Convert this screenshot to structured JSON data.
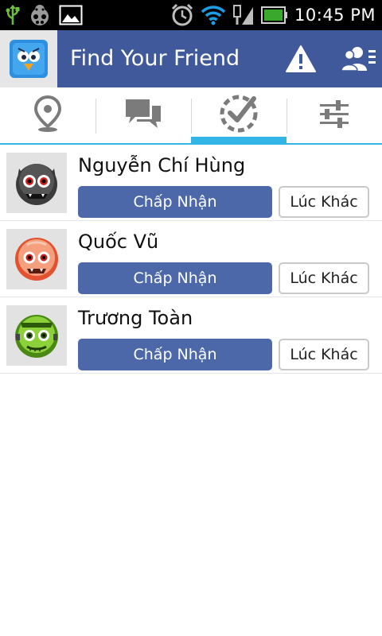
{
  "status_bar": {
    "time": "10:45 PM",
    "left_icons": [
      "usb-icon",
      "bug-icon",
      "image-icon"
    ],
    "right_icons": [
      "alarm-icon",
      "wifi-icon",
      "signal-icon",
      "battery-icon"
    ]
  },
  "action_bar": {
    "title": "Find Your Friend",
    "icons": [
      "app-logo-icon",
      "warning-icon",
      "friends-list-icon"
    ],
    "color": "#3f599a"
  },
  "tabs": [
    {
      "icon": "location-icon",
      "selected": false
    },
    {
      "icon": "chat-icon",
      "selected": false
    },
    {
      "icon": "check-circle-icon",
      "selected": true
    },
    {
      "icon": "settings-sliders-icon",
      "selected": false
    }
  ],
  "requests": [
    {
      "name": "Nguyễn Chí Hùng",
      "avatar": "dark-monster-face",
      "accept_label": "Chấp Nhận",
      "later_label": "Lúc Khác"
    },
    {
      "name": "Quốc Vũ",
      "avatar": "orange-monster-face",
      "accept_label": "Chấp Nhận",
      "later_label": "Lúc Khác"
    },
    {
      "name": "Trương Toàn",
      "avatar": "green-monster-face",
      "accept_label": "Chấp Nhận",
      "later_label": "Lúc Khác"
    }
  ],
  "colors": {
    "accent": "#33b5e5",
    "accept_button": "#4c68a8"
  }
}
